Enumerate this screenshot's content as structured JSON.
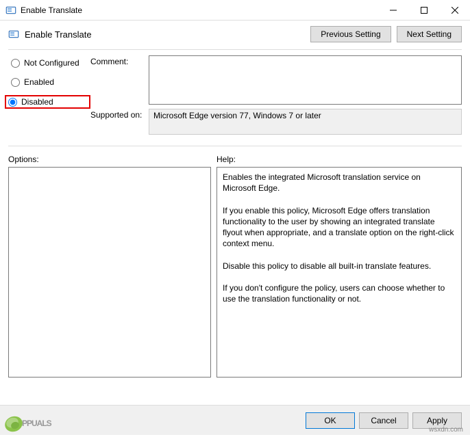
{
  "window": {
    "title": "Enable Translate"
  },
  "header": {
    "title": "Enable Translate",
    "prev": "Previous Setting",
    "next": "Next Setting"
  },
  "radios": {
    "not_configured": "Not Configured",
    "enabled": "Enabled",
    "disabled": "Disabled",
    "selected": "disabled"
  },
  "fields": {
    "comment_label": "Comment:",
    "comment_value": "",
    "supported_label": "Supported on:",
    "supported_value": "Microsoft Edge version 77, Windows 7 or later"
  },
  "sections": {
    "options_label": "Options:",
    "help_label": "Help:",
    "help_text": "Enables the integrated Microsoft translation service on Microsoft Edge.\n\nIf you enable this policy, Microsoft Edge offers translation functionality to the user by showing an integrated translate flyout when appropriate, and a translate option on the right-click context menu.\n\nDisable this policy to disable all built-in translate features.\n\nIf you don't configure the policy, users can choose whether to use the translation functionality or not."
  },
  "buttons": {
    "ok": "OK",
    "cancel": "Cancel",
    "apply": "Apply"
  },
  "watermark": {
    "site": "wsxdn.com",
    "brand": "PPUALS"
  }
}
